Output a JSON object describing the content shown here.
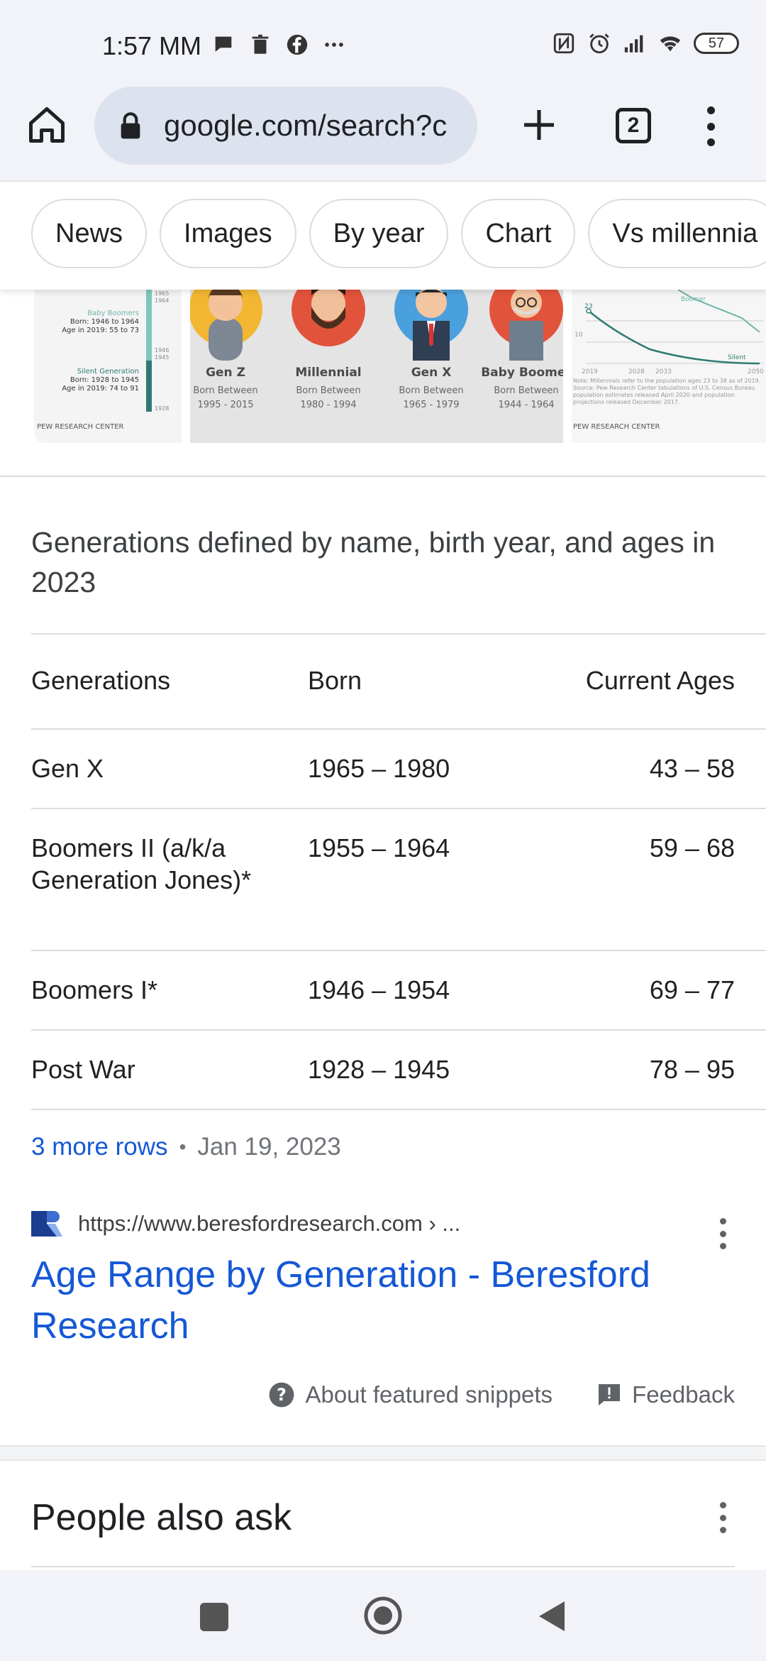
{
  "status_bar": {
    "time": "1:57 MM",
    "battery": "57",
    "left_icons": [
      "chat-bubble-icon",
      "trash-icon",
      "facebook-icon",
      "more-dots-icon"
    ],
    "right_icons": [
      "nfc-icon",
      "alarm-icon",
      "signal-icon",
      "wifi-icon",
      "battery-icon"
    ]
  },
  "toolbar": {
    "url": "google.com/search?c",
    "tab_count": "2"
  },
  "chips": [
    "News",
    "Images",
    "By year",
    "Chart",
    "Vs millennia"
  ],
  "images": {
    "img1": {
      "lines": [
        "Baby Boomers",
        "Born: 1946 to 1964",
        "Age in 2019: 55 to 73",
        "Silent Generation",
        "Born: 1928 to 1945",
        "Age in 2019: 74 to 91",
        "PEW RESEARCH CENTER"
      ],
      "ticks": [
        "1965",
        "1964",
        "1946",
        "1945",
        "1928"
      ]
    },
    "img2": {
      "avatars": [
        {
          "name": "Gen Z",
          "sub": "Born Between",
          "years": "1995 - 2015"
        },
        {
          "name": "Millennial",
          "sub": "Born Between",
          "years": "1980 - 1994"
        },
        {
          "name": "Gen X",
          "sub": "Born Between",
          "years": "1965 - 1979"
        },
        {
          "name": "Baby Boomer",
          "sub": "Born Between",
          "years": "1944 - 1964"
        }
      ]
    },
    "img3": {
      "labels": [
        "Boomer",
        "23",
        "10",
        "Silent",
        "2019",
        "2028",
        "2033",
        "2050"
      ],
      "note": "Note: Millennials refer to the population ages 23 to 38 as of 2019. Source: Pew Research Center tabulations of U.S. Census Bureau population estimates released April 2020 and population projections released December 2017.",
      "credit": "PEW RESEARCH CENTER"
    }
  },
  "snippet": {
    "title": "Generations defined by name, birth year, and ages in 2023",
    "headers": [
      "Generations",
      "Born",
      "Current Ages"
    ],
    "rows": [
      {
        "gen": "Gen X",
        "born": "1965 – 1980",
        "ages": "43 – 58"
      },
      {
        "gen": "Boomers II (a/k/a Generation Jones)*",
        "born": "1955 – 1964",
        "ages": "59 – 68"
      },
      {
        "gen": "Boomers I*",
        "born": "1946 – 1954",
        "ages": "69 – 77"
      },
      {
        "gen": "Post War",
        "born": "1928 – 1945",
        "ages": "78 – 95"
      }
    ],
    "more_rows": "3 more rows",
    "date": "Jan 19, 2023"
  },
  "result": {
    "source_url": "https://www.beresfordresearch.com › ...",
    "title": "Age Range by Generation - Beresford Research",
    "about_snippets": "About featured snippets",
    "feedback": "Feedback"
  },
  "paa": {
    "title": "People also ask"
  },
  "colors": {
    "link": "#1558d6",
    "chrome_bg": "#f2f3f8",
    "url_pill": "#dde3ee"
  }
}
